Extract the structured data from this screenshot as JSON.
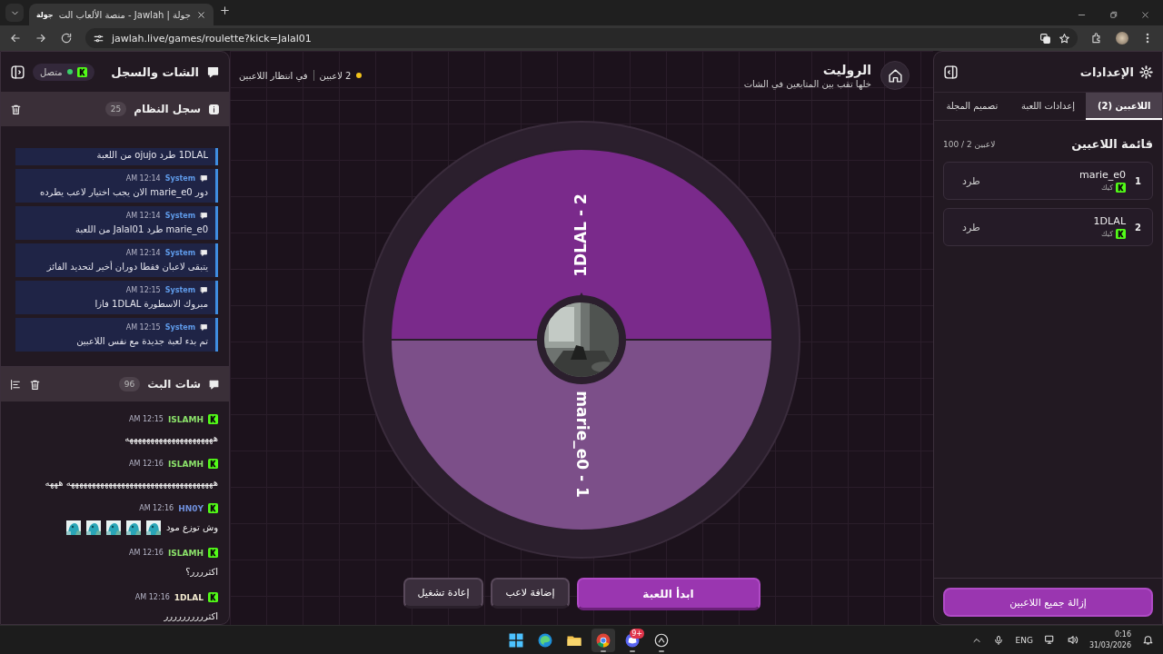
{
  "browser": {
    "favicon_text": "جولة",
    "tab_title": "جولة | Jawlah - منصة الألعاب الت",
    "url": "jawlah.live/games/roulette?kick=Jalal01"
  },
  "chat_panel": {
    "title": "الشات والسجل",
    "connection": {
      "label": "متصل",
      "connected": true
    },
    "system_log": {
      "title": "سجل النظام",
      "count": "25",
      "entries": [
        {
          "text": "1DLAL طرد ojujo من اللعبة"
        },
        {
          "sender": "System",
          "time": "12:14 AM",
          "text": "دور marie_e0 الان يجب اختيار لاعب يطرده"
        },
        {
          "sender": "System",
          "time": "12:14 AM",
          "text": "marie_e0 طرد Jalal01 من اللعبة"
        },
        {
          "sender": "System",
          "time": "12:14 AM",
          "text": "يتبقى لاعبان فقطا دوران أخير لتحديد الفائز"
        },
        {
          "sender": "System",
          "time": "12:15 AM",
          "text": "مبروك الاسطورة 1DLAL فازا"
        },
        {
          "sender": "System",
          "time": "12:15 AM",
          "text": "تم بدء لعبة جديدة مع نفس اللاعبين"
        }
      ]
    },
    "stream_chat": {
      "title": "شات البث",
      "count": "96",
      "messages": [
        {
          "user": "ISLAMH",
          "color": "#8be26a",
          "time": "12:15 AM",
          "text": "هههههههههههههههههههههه"
        },
        {
          "user": "ISLAMH",
          "color": "#8be26a",
          "time": "12:16 AM",
          "text": "هههههههههههههههههههههههههههههههههههه هههه"
        },
        {
          "user": "HN0Y",
          "color": "#6f8fdc",
          "time": "12:16 AM",
          "text": "وش توزع مود"
        },
        {
          "user": "ISLAMH",
          "color": "#8be26a",
          "time": "12:16 AM",
          "text": "اكثرررر؟"
        },
        {
          "user": "1DLAL",
          "color": "#f3ead0",
          "time": "12:16 AM",
          "text": "اكثرررررررررر"
        }
      ]
    }
  },
  "stage": {
    "title": "الروليت",
    "subtitle": "خلها تقب بين المتابعين في الشات",
    "player_count": "2 لاعبين",
    "status": "في انتظار اللاعبين",
    "wheel": {
      "segments": [
        {
          "label": "1DLAL - 2",
          "color": "#7a2a8b"
        },
        {
          "label": "marie_e0 - 1",
          "color": "#7c4f89"
        }
      ]
    },
    "buttons": [
      {
        "label": "ابدأ اللعبة",
        "kind": "primary"
      },
      {
        "label": "إضافة لاعب",
        "kind": "secondary"
      },
      {
        "label": "إعادة تشغيل",
        "kind": "secondary"
      }
    ]
  },
  "settings_panel": {
    "title": "الإعدادات",
    "tabs": [
      {
        "label": "اللاعبين (2)",
        "selected": true
      },
      {
        "label": "إعدادات اللعبة",
        "selected": false
      },
      {
        "label": "تصميم المجلة",
        "selected": false
      }
    ],
    "list_title": "قائمة اللاعبين",
    "capacity": "100 / 2 لاعبين",
    "players": [
      {
        "number": "1",
        "name": "marie_e0",
        "platform": "كيك",
        "action": "طرد"
      },
      {
        "number": "2",
        "name": "1DLAL",
        "platform": "كيك",
        "action": "طرد"
      }
    ],
    "remove_all": "إزالة جميع اللاعبين"
  },
  "taskbar": {
    "apps": [
      {
        "kind": "start",
        "running": false,
        "selected": false
      },
      {
        "kind": "edge",
        "running": false,
        "selected": false
      },
      {
        "kind": "folder",
        "running": false,
        "selected": false
      },
      {
        "kind": "chrome",
        "running": true,
        "selected": true
      },
      {
        "kind": "discord",
        "running": true,
        "selected": false,
        "badge": "9+"
      },
      {
        "kind": "app",
        "running": true,
        "selected": false
      }
    ],
    "language": "ENG",
    "time": "0:16",
    "date": "31/03/2026"
  }
}
